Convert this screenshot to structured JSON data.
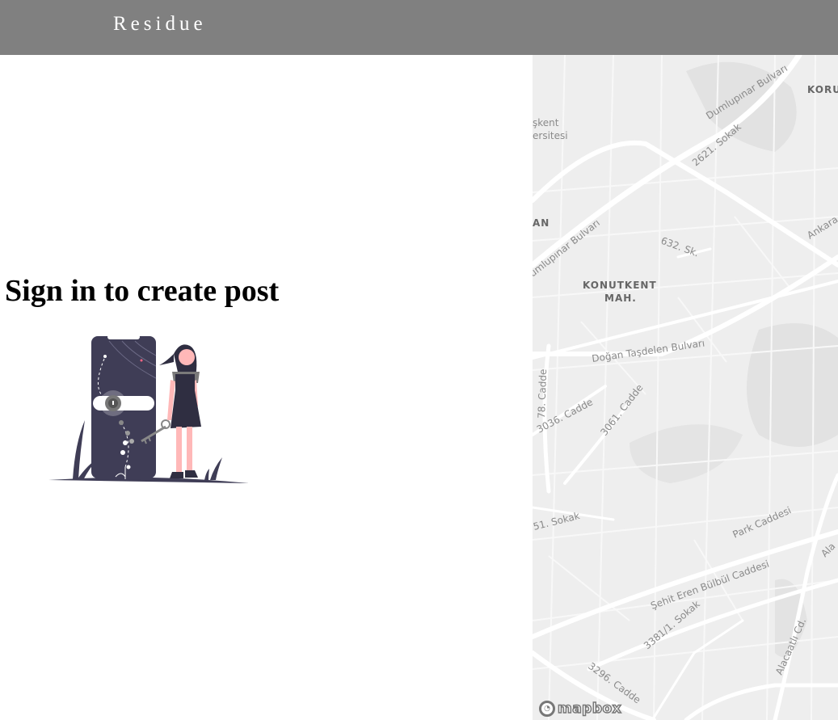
{
  "header": {
    "brand": "Residue"
  },
  "main": {
    "heading": "Sign in to create post"
  },
  "map": {
    "attribution": "mapbox",
    "labels": [
      "Dumlupınar Bulvarı",
      "KORU",
      "şkent",
      "ersitesi",
      "2621. Sokak",
      "AN",
      "Ankara",
      "umlupınar Bulvarı",
      "632. Sk.",
      "KONUTKENT",
      "MAH.",
      "Doğan Taşdelen Bulvarı",
      "78. Cadde",
      "3036. Cadde",
      "3061. Cadde",
      "51. Sokak",
      "Park Caddesi",
      "Ala",
      "Şehit Eren Bülbül Caddesi",
      "3381/1. Sokak",
      "Alacaatlı Cd.",
      "3296. Cadde"
    ]
  },
  "colors": {
    "header_bg": "#808080",
    "map_bg": "#eeeeee",
    "road": "#ffffff",
    "illustration_dark": "#3f3d56",
    "illustration_skin": "#ffb8b8"
  }
}
